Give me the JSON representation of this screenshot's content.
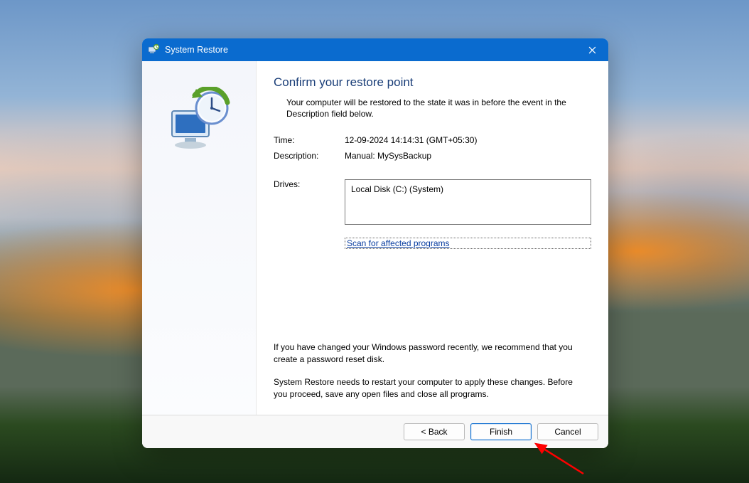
{
  "window": {
    "title": "System Restore"
  },
  "page": {
    "heading": "Confirm your restore point",
    "intro": "Your computer will be restored to the state it was in before the event in the Description field below.",
    "fields": {
      "time_label": "Time:",
      "time_value": "12-09-2024 14:14:31 (GMT+05:30)",
      "description_label": "Description:",
      "description_value": "Manual: MySysBackup",
      "drives_label": "Drives:",
      "drives_value": "Local Disk (C:) (System)"
    },
    "scan_link": "Scan for affected programs",
    "note_password": "If you have changed your Windows password recently, we recommend that you create a password reset disk.",
    "note_restart": "System Restore needs to restart your computer to apply these changes. Before you proceed, save any open files and close all programs."
  },
  "buttons": {
    "back": "< Back",
    "finish": "Finish",
    "cancel": "Cancel"
  }
}
